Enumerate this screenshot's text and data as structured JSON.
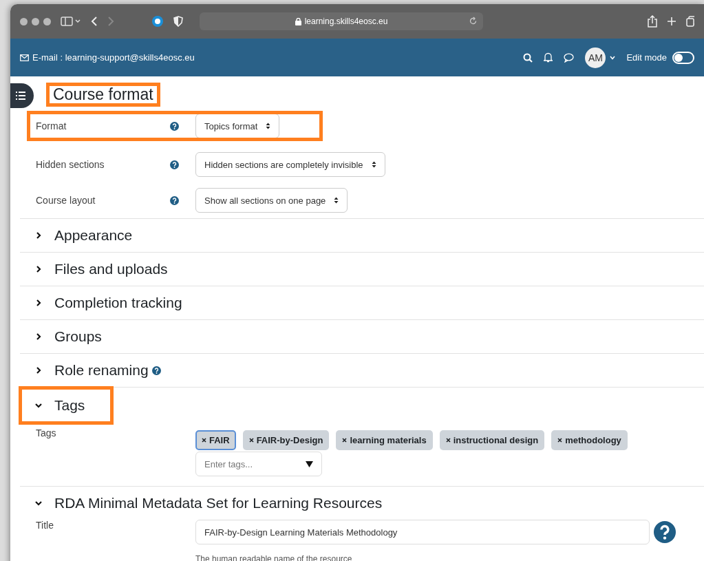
{
  "browser": {
    "url": "learning.skills4eosc.eu"
  },
  "navbar": {
    "email": "E-mail : learning-support@skills4eosc.eu",
    "avatar": "AM",
    "edit_mode": {
      "label": "Edit mode",
      "on": false
    }
  },
  "course_format": {
    "heading": "Course format",
    "highlighted": true,
    "fields": [
      {
        "label": "Format",
        "value": "Topics format",
        "highlighted": true
      },
      {
        "label": "Hidden sections",
        "value": "Hidden sections are completely invisible",
        "highlighted": false
      },
      {
        "label": "Course layout",
        "value": "Show all sections on one page",
        "highlighted": false
      }
    ]
  },
  "sections": [
    {
      "kind": "plain",
      "title": "Appearance",
      "expanded": false,
      "highlighted": false,
      "help": false
    },
    {
      "kind": "plain",
      "title": "Files and uploads",
      "expanded": false,
      "highlighted": false,
      "help": false
    },
    {
      "kind": "plain",
      "title": "Completion tracking",
      "expanded": false,
      "highlighted": false,
      "help": false
    },
    {
      "kind": "plain",
      "title": "Groups",
      "expanded": false,
      "highlighted": false,
      "help": false
    },
    {
      "kind": "plain",
      "title": "Role renaming",
      "expanded": false,
      "highlighted": false,
      "help": true
    },
    {
      "kind": "tags",
      "title": "Tags",
      "expanded": true,
      "highlighted": true,
      "help": false,
      "label": "Tags",
      "placeholder": "Enter tags...",
      "tags": [
        {
          "label": "FAIR",
          "selected": true
        },
        {
          "label": "FAIR-by-Design",
          "selected": false
        },
        {
          "label": "learning materials",
          "selected": false
        },
        {
          "label": "instructional design",
          "selected": false
        },
        {
          "label": "methodology",
          "selected": false
        }
      ]
    },
    {
      "kind": "text",
      "title": "RDA Minimal Metadata Set for Learning Resources",
      "expanded": true,
      "highlighted": false,
      "help": false,
      "label": "Title",
      "value": "FAIR-by-Design Learning Materials Methodology",
      "hint": "The human readable name of the resource"
    }
  ]
}
